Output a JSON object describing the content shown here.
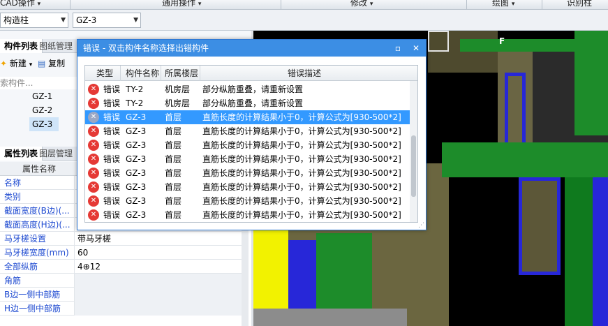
{
  "ribbon": {
    "groups": [
      "CAD操作",
      "通用操作",
      "修改",
      "绘图",
      "识别柱"
    ]
  },
  "combo_bar": {
    "type_combo": "构造柱",
    "name_combo": "GZ-3"
  },
  "component_panel": {
    "tab_active": "构件列表",
    "tab_other": "图纸管理",
    "new_label": "新建",
    "copy_label": "复制",
    "search_placeholder": "索构件...",
    "items": [
      "GZ-1",
      "GZ-2",
      "GZ-3"
    ],
    "selected_item": "GZ-3"
  },
  "property_panel": {
    "tab_active": "属性列表",
    "tab_other": "图层管理",
    "header_name": "属性名称",
    "rows": [
      {
        "name": "名称",
        "value": ""
      },
      {
        "name": "类别",
        "value": ""
      },
      {
        "name": "截面宽度(B边)(...",
        "value": ""
      },
      {
        "name": "截面高度(H边)(...",
        "value": ""
      },
      {
        "name": "马牙槎设置",
        "value": "带马牙槎"
      },
      {
        "name": "马牙槎宽度(mm)",
        "value": "60"
      },
      {
        "name": "全部纵筋",
        "value": "4⊕12"
      },
      {
        "name": "角筋",
        "value": ""
      },
      {
        "name": "B边一侧中部筋",
        "value": ""
      },
      {
        "name": "H边一侧中部筋",
        "value": ""
      }
    ]
  },
  "viewport": {
    "corner_label": "F"
  },
  "error_dialog": {
    "title": "错误 - 双击构件名称选择出错构件",
    "columns": [
      "类型",
      "构件名称",
      "所属楼层",
      "错误描述"
    ],
    "rows": [
      {
        "type": "错误",
        "component": "TY-2",
        "floor": "机房层",
        "description": "部分纵筋重叠，请重新设置",
        "selected": false
      },
      {
        "type": "错误",
        "component": "TY-2",
        "floor": "机房层",
        "description": "部分纵筋重叠，请重新设置",
        "selected": false
      },
      {
        "type": "错误",
        "component": "GZ-3",
        "floor": "首层",
        "description": "直筋长度的计算结果小于0，计算公式为[930-500*2]",
        "selected": true
      },
      {
        "type": "错误",
        "component": "GZ-3",
        "floor": "首层",
        "description": "直筋长度的计算结果小于0，计算公式为[930-500*2]",
        "selected": false
      },
      {
        "type": "错误",
        "component": "GZ-3",
        "floor": "首层",
        "description": "直筋长度的计算结果小于0，计算公式为[930-500*2]",
        "selected": false
      },
      {
        "type": "错误",
        "component": "GZ-3",
        "floor": "首层",
        "description": "直筋长度的计算结果小于0，计算公式为[930-500*2]",
        "selected": false
      },
      {
        "type": "错误",
        "component": "GZ-3",
        "floor": "首层",
        "description": "直筋长度的计算结果小于0，计算公式为[930-500*2]",
        "selected": false
      },
      {
        "type": "错误",
        "component": "GZ-3",
        "floor": "首层",
        "description": "直筋长度的计算结果小于0，计算公式为[930-500*2]",
        "selected": false
      },
      {
        "type": "错误",
        "component": "GZ-3",
        "floor": "首层",
        "description": "直筋长度的计算结果小于0，计算公式为[930-500*2]",
        "selected": false
      },
      {
        "type": "错误",
        "component": "GZ-3",
        "floor": "首层",
        "description": "直筋长度的计算结果小于0，计算公式为[930-500*2]",
        "selected": false
      }
    ]
  },
  "colors": {
    "dialog_title_bg": "#3c8ee4",
    "selection": "#3399ff",
    "error_icon": "#e53935",
    "model_green": "#1d8c2a",
    "model_blue": "#2727d8",
    "model_yellow": "#f2f200",
    "model_olive": "#5a5636"
  }
}
